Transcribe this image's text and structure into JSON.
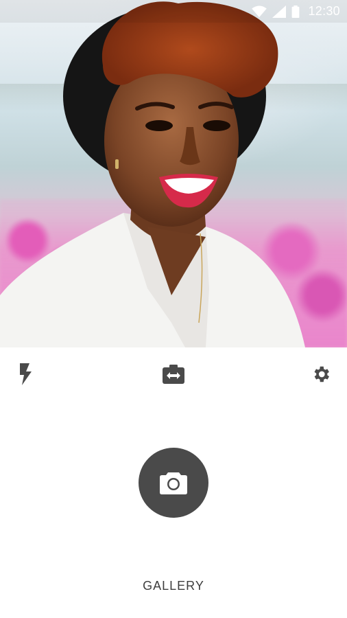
{
  "status_bar": {
    "time": "12:30",
    "icons": [
      "wifi-icon",
      "signal-icon",
      "battery-icon"
    ],
    "icon_color": "#ffffff"
  },
  "viewfinder": {
    "subject": "photo-preview"
  },
  "camera_controls": {
    "flash_icon": "flash-icon",
    "switch_camera_icon": "switch-camera-icon",
    "settings_icon": "settings-icon",
    "icon_color": "#4a4a4a"
  },
  "shutter": {
    "icon": "camera-icon",
    "background": "#4a4a4a"
  },
  "gallery": {
    "label": "GALLERY"
  }
}
